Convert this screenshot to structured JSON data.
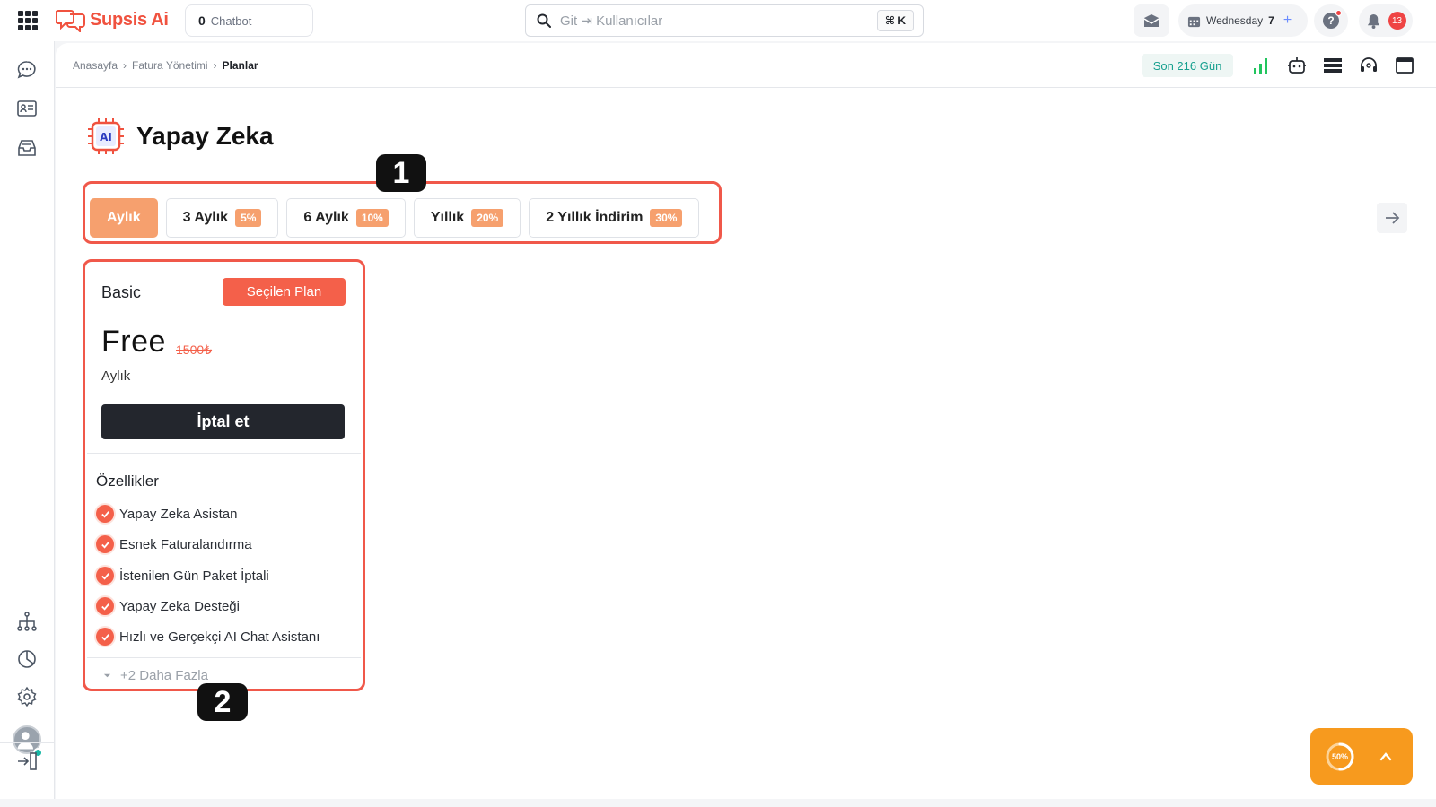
{
  "app": {
    "brand": "Supsis Ai",
    "chatbot_count": "0",
    "chatbot_label": "Chatbot"
  },
  "search": {
    "placeholder": "Git ⇥ Kullanıcılar",
    "shortcut": "⌘ K"
  },
  "header": {
    "date_day": "Wednesday",
    "date_num": "7",
    "date_plus": "+",
    "help": "?",
    "notifications": "13"
  },
  "breadcrumb": {
    "items": [
      "Anasayfa",
      "Fatura Yönetimi",
      "Planlar"
    ],
    "sep": "›"
  },
  "toolbar": {
    "days": "Son 216 Gün"
  },
  "page": {
    "title": "Yapay Zeka",
    "icon_text": "AI"
  },
  "annotations": [
    "1",
    "2"
  ],
  "tabs": [
    {
      "label": "Aylık",
      "discount": "",
      "active": true
    },
    {
      "label": "3 Aylık",
      "discount": "5%"
    },
    {
      "label": "6 Aylık",
      "discount": "10%"
    },
    {
      "label": "Yıllık",
      "discount": "20%"
    },
    {
      "label": "2 Yıllık İndirim",
      "discount": "30%"
    }
  ],
  "plan": {
    "name": "Basic",
    "selected_label": "Seçilen Plan",
    "price": "Free",
    "old_price": "1500₺",
    "period": "Aylık",
    "cancel_label": "İptal et",
    "features_title": "Özellikler",
    "features": [
      "Yapay Zeka Asistan",
      "Esnek Faturalandırma",
      "İstenilen Gün Paket İptali",
      "Yapay Zeka Desteği",
      "Hızlı ve Gerçekçi AI Chat Asistanı"
    ],
    "more_label": "+2 Daha Fazla"
  },
  "progress": {
    "value": 50,
    "label": "50%"
  },
  "colors": {
    "brand": "#f0523f",
    "accent": "#f4604a",
    "tab_active": "#f6a06e",
    "highlight": "#f0584a",
    "progress": "#f79a1e",
    "success": "#16b8a6"
  }
}
